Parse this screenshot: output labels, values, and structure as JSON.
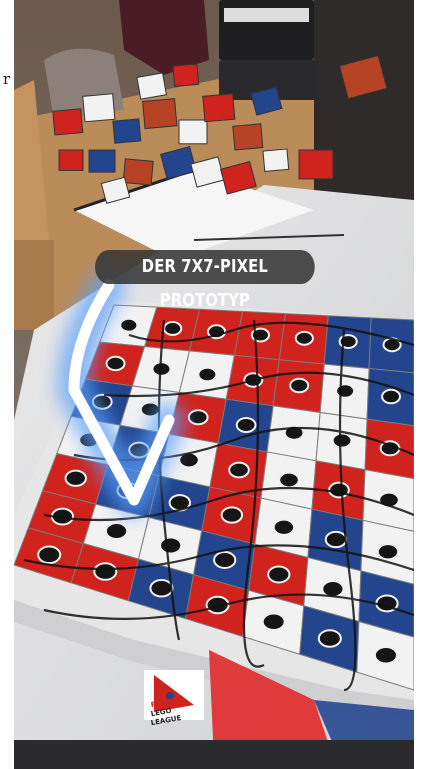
{
  "photo": {
    "caption": "DER 7X7-PIXEL PROTOTYP",
    "left_edge_text": "r",
    "logo_text": [
      "FIRST",
      "LEGO",
      "LEAGUE"
    ]
  },
  "colors": {
    "caption_bg": "#373737",
    "tile_red": "#d0231d",
    "tile_blue": "#22458e",
    "tile_white": "#f2f2f2",
    "arrow_glow": "#5aa0ff"
  },
  "icons": [
    "arrow-stroke-icon",
    "first-lego-league-logo"
  ]
}
